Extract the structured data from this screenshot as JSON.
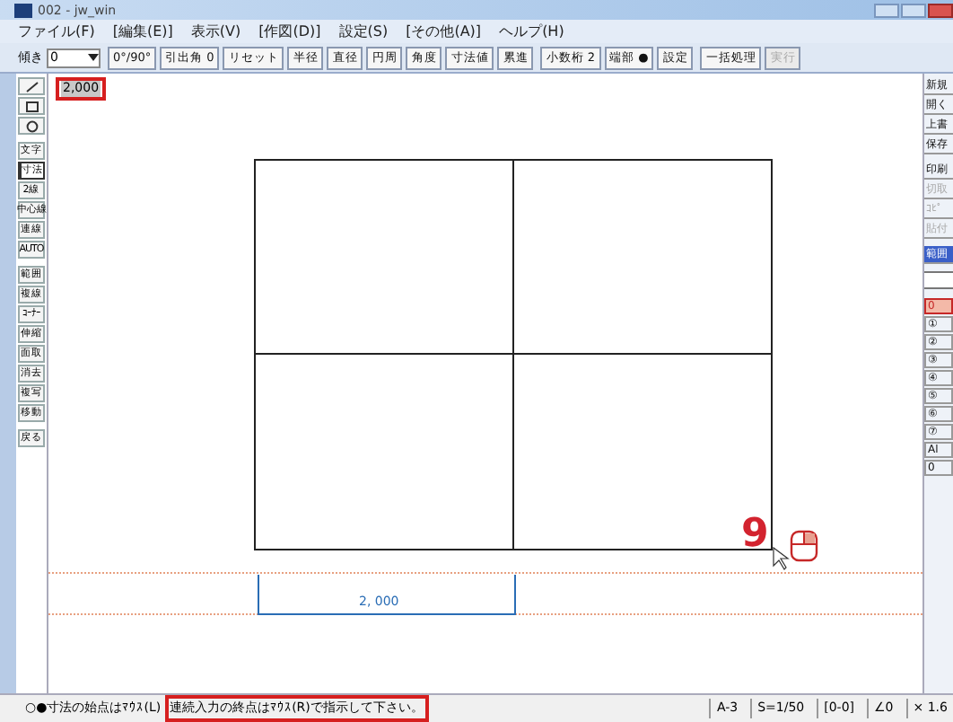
{
  "window": {
    "title": "002 - jw_win"
  },
  "menu": [
    "ファイル(F)",
    "[編集(E)]",
    "表示(V)",
    "[作図(D)]",
    "設定(S)",
    "[その他(A)]",
    "ヘルプ(H)"
  ],
  "toolbar": {
    "angle_label": "傾き",
    "angle_value": "0",
    "buttons": [
      {
        "label": "0°/90°",
        "disabled": false
      },
      {
        "label": "引出角 0",
        "disabled": false
      },
      {
        "label": "リセット",
        "disabled": false
      },
      {
        "label": "半径",
        "disabled": false
      },
      {
        "label": "直径",
        "disabled": false
      },
      {
        "label": "円周",
        "disabled": false
      },
      {
        "label": "角度",
        "disabled": false
      },
      {
        "label": "寸法値",
        "disabled": false
      },
      {
        "label": "累進",
        "disabled": false
      },
      {
        "label": "小数桁 2",
        "disabled": false
      },
      {
        "label": "端部 ●",
        "disabled": false
      },
      {
        "label": "設定",
        "disabled": false
      },
      {
        "label": "一括処理",
        "disabled": false
      },
      {
        "label": "実行",
        "disabled": true
      }
    ]
  },
  "input_value": "2,000",
  "left_tools": [
    {
      "kind": "line",
      "selected": false
    },
    {
      "kind": "rect",
      "selected": false
    },
    {
      "kind": "circle",
      "selected": false
    },
    {
      "kind": "text",
      "label": "文字",
      "selected": false
    },
    {
      "kind": "text",
      "label": "寸法",
      "selected": true
    },
    {
      "kind": "text",
      "label": "2線",
      "selected": false
    },
    {
      "kind": "text",
      "label": "中心線",
      "selected": false
    },
    {
      "kind": "text",
      "label": "連線",
      "selected": false
    },
    {
      "kind": "text",
      "label": "AUTO",
      "selected": false
    },
    {
      "kind": "text",
      "label": "範囲",
      "selected": false
    },
    {
      "kind": "text",
      "label": "複線",
      "selected": false
    },
    {
      "kind": "text",
      "label": "ｺｰﾅｰ",
      "selected": false
    },
    {
      "kind": "text",
      "label": "伸縮",
      "selected": false
    },
    {
      "kind": "text",
      "label": "面取",
      "selected": false
    },
    {
      "kind": "text",
      "label": "消去",
      "selected": false
    },
    {
      "kind": "text",
      "label": "複写",
      "selected": false
    },
    {
      "kind": "text",
      "label": "移動",
      "selected": false
    },
    {
      "kind": "text",
      "label": "戻る",
      "selected": false
    }
  ],
  "right_tools": [
    {
      "label": "新規",
      "disabled": false,
      "selected": false
    },
    {
      "label": "開く",
      "disabled": false,
      "selected": false
    },
    {
      "label": "上書",
      "disabled": false,
      "selected": false
    },
    {
      "label": "保存",
      "disabled": false,
      "selected": false
    },
    {
      "label": "印刷",
      "disabled": false,
      "selected": false
    },
    {
      "label": "切取",
      "disabled": true,
      "selected": false
    },
    {
      "label": "ｺﾋﾟ",
      "disabled": true,
      "selected": false
    },
    {
      "label": "貼付",
      "disabled": true,
      "selected": false
    },
    {
      "label": "範囲",
      "disabled": false,
      "selected": true
    }
  ],
  "layers": [
    {
      "label": "0",
      "selected": true
    },
    {
      "label": "①",
      "selected": false
    },
    {
      "label": "②",
      "selected": false
    },
    {
      "label": "③",
      "selected": false
    },
    {
      "label": "④",
      "selected": false
    },
    {
      "label": "⑤",
      "selected": false
    },
    {
      "label": "⑥",
      "selected": false
    },
    {
      "label": "⑦",
      "selected": false
    },
    {
      "label": "Al",
      "selected": false
    },
    {
      "label": "0",
      "selected": false
    }
  ],
  "drawing": {
    "dimension_label": "2, 000",
    "step_number": "9"
  },
  "status_bar": {
    "prompt": "○●寸法の始点はﾏｳｽ(L)",
    "highlighted_prompt": "連続入力の終点はﾏｳｽ(R)で指示して下さい。",
    "fields": [
      "A-3",
      "S=1/50",
      "[0-0]",
      "∠0",
      "× 1.6"
    ]
  }
}
